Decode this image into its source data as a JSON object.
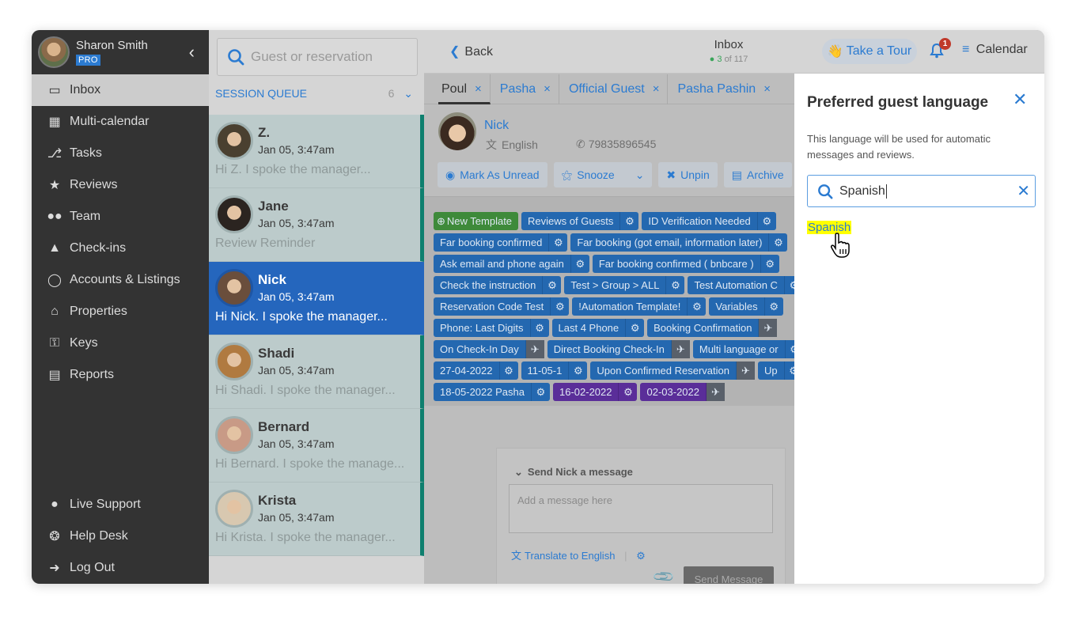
{
  "sidebar": {
    "user_name": "Sharon Smith",
    "badge": "PRO",
    "collapse_icon": "chevron-left-icon",
    "items": [
      {
        "label": "Inbox",
        "icon": "inbox-tray-icon",
        "active": true
      },
      {
        "label": "Multi-calendar",
        "icon": "calendar-grid-icon"
      },
      {
        "label": "Tasks",
        "icon": "vacuum-cleaner-icon"
      },
      {
        "label": "Reviews",
        "icon": "star-icon"
      },
      {
        "label": "Team",
        "icon": "users-icon"
      },
      {
        "label": "Check-ins",
        "icon": "concierge-bell-icon"
      },
      {
        "label": "Accounts & Listings",
        "icon": "user-circle-icon"
      },
      {
        "label": "Properties",
        "icon": "house-icon"
      },
      {
        "label": "Keys",
        "icon": "key-icon"
      },
      {
        "label": "Reports",
        "icon": "bar-chart-icon"
      }
    ],
    "bottom_items": [
      {
        "label": "Live Support",
        "icon": "chat-bubble-icon"
      },
      {
        "label": "Help Desk",
        "icon": "lifebuoy-icon"
      },
      {
        "label": "Log Out",
        "icon": "logout-icon"
      }
    ]
  },
  "queue": {
    "search_placeholder": "Guest or reservation",
    "header": "SESSION QUEUE",
    "count": "6",
    "items": [
      {
        "name": "Z.",
        "time": "Jan 05, 3:47am",
        "preview": "Hi Z. I spoke the manager...",
        "avatar_color": "#4a4030"
      },
      {
        "name": "Jane",
        "time": "Jan 05, 3:47am",
        "preview": "Review Reminder",
        "avatar_color": "#2b2420"
      },
      {
        "name": "Nick",
        "time": "Jan 05, 3:47am",
        "preview": "Hi Nick. I spoke the manager...",
        "avatar_color": "#6a4e3c",
        "selected": true
      },
      {
        "name": "Shadi",
        "time": "Jan 05, 3:47am",
        "preview": "Hi Shadi. I spoke the manager...",
        "avatar_color": "#b07a40"
      },
      {
        "name": "Bernard",
        "time": "Jan 05, 3:47am",
        "preview": "Hi Bernard. I spoke the manage...",
        "avatar_color": "#c89a86"
      },
      {
        "name": "Krista",
        "time": "Jan 05, 3:47am",
        "preview": "Hi Krista. I spoke the manager...",
        "avatar_color": "#d8c8b0"
      }
    ]
  },
  "topbar": {
    "back_label": "Back",
    "title": "Inbox",
    "position_current": "3",
    "position_total": "of 117",
    "tour_label": "Take a Tour",
    "notifications_count": "1",
    "calendar_label": "Calendar"
  },
  "tabs": [
    {
      "label": "Poul",
      "active": true
    },
    {
      "label": "Pasha"
    },
    {
      "label": "Official Guest"
    },
    {
      "label": "Pasha Pashin"
    }
  ],
  "guest": {
    "name": "Nick",
    "language": "English",
    "phone": "79835896545"
  },
  "actions": [
    {
      "label": "Mark As Unread",
      "icon": "eye-slash-icon"
    },
    {
      "label": "Snooze",
      "icon": "bell-snooze-icon"
    },
    {
      "label": "Unpin",
      "icon": "unpin-icon"
    },
    {
      "label": "Archive",
      "icon": "archive-icon"
    }
  ],
  "templates": {
    "new_label": "New Template",
    "rows": [
      [
        {
          "label": "Reviews of Guests",
          "kind": "gear"
        },
        {
          "label": "ID Verification Needed",
          "kind": "gear"
        }
      ],
      [
        {
          "label": "Far booking confirmed",
          "kind": "gear"
        },
        {
          "label": "Far booking (got email, information later)",
          "kind": "gear"
        }
      ],
      [
        {
          "label": "Ask email and phone again",
          "kind": "gear"
        },
        {
          "label": "Far booking confirmed ( bnbcare )",
          "kind": "gear"
        }
      ],
      [
        {
          "label": "Check the instruction",
          "kind": "gear"
        },
        {
          "label": "Test > Group > ALL",
          "kind": "gear"
        },
        {
          "label": "Test Automation C",
          "kind": "gear"
        }
      ],
      [
        {
          "label": "Reservation Code Test",
          "kind": "gear"
        },
        {
          "label": "!Automation Template!",
          "kind": "gear"
        },
        {
          "label": "Variables",
          "kind": "gear"
        }
      ],
      [
        {
          "label": "Phone: Last Digits",
          "kind": "gear"
        },
        {
          "label": "Last 4 Phone",
          "kind": "gear"
        },
        {
          "label": "Booking Confirmation",
          "kind": "auto"
        }
      ],
      [
        {
          "label": "On Check-In Day",
          "kind": "auto"
        },
        {
          "label": "Direct Booking Check-In",
          "kind": "auto"
        },
        {
          "label": "Multi language or",
          "kind": "gear"
        }
      ],
      [
        {
          "label": "27-04-2022",
          "kind": "gear"
        },
        {
          "label": "11-05-1",
          "kind": "gear"
        },
        {
          "label": "Upon Confirmed Reservation",
          "kind": "auto"
        },
        {
          "label": "Up",
          "kind": "gear"
        }
      ],
      [
        {
          "label": "18-05-2022 Pasha",
          "kind": "gear"
        },
        {
          "label": "16-02-2022",
          "kind": "gear",
          "color": "purple"
        },
        {
          "label": "02-03-2022",
          "kind": "auto",
          "color": "purple"
        }
      ]
    ]
  },
  "compose": {
    "title": "Send Nick a message",
    "placeholder": "Add a message here",
    "translate_label": "Translate to English",
    "send_label": "Send Message"
  },
  "language_panel": {
    "title": "Preferred guest language",
    "description": "This language will be used for automatic messages and reviews.",
    "search_value": "Spanish",
    "result": "Spanish"
  },
  "colors": {
    "accent": "#2b7bd1",
    "selected_row": "#2566bd",
    "template_blue": "#2468b0",
    "template_purple": "#5a2e99",
    "highlight": "#ffff00"
  }
}
